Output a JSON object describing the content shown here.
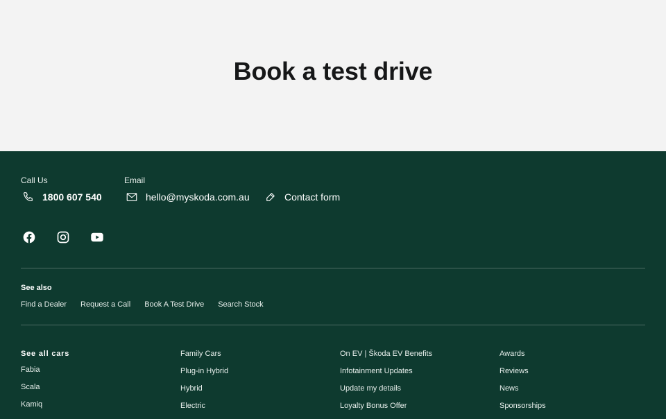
{
  "hero": {
    "title": "Book a test drive"
  },
  "contact": {
    "call_label": "Call Us",
    "phone": "1800 607 540",
    "email_label": "Email",
    "email": "hello@myskoda.com.au",
    "contact_form": "Contact form"
  },
  "social": {
    "icons": [
      "facebook-icon",
      "instagram-icon",
      "youtube-icon"
    ]
  },
  "see_also": {
    "title": "See also",
    "links": [
      "Find a Dealer",
      "Request a Call",
      "Book A Test Drive",
      "Search Stock"
    ]
  },
  "footer_columns": [
    {
      "items": [
        "See all cars",
        "Fabia",
        "Scala",
        "Kamiq"
      ]
    },
    {
      "items": [
        "Family Cars",
        "Plug-in Hybrid",
        "Hybrid",
        "Electric"
      ]
    },
    {
      "items": [
        "On EV | Škoda EV Benefits",
        "Infotainment Updates",
        "Update my details",
        "Loyalty Bonus Offer"
      ]
    },
    {
      "items": [
        "Awards",
        "Reviews",
        "News",
        "Sponsorships"
      ]
    }
  ],
  "colors": {
    "footer_bg": "#0e3a2f",
    "hero_bg": "#f3f3f3",
    "text": "#ffffff"
  }
}
